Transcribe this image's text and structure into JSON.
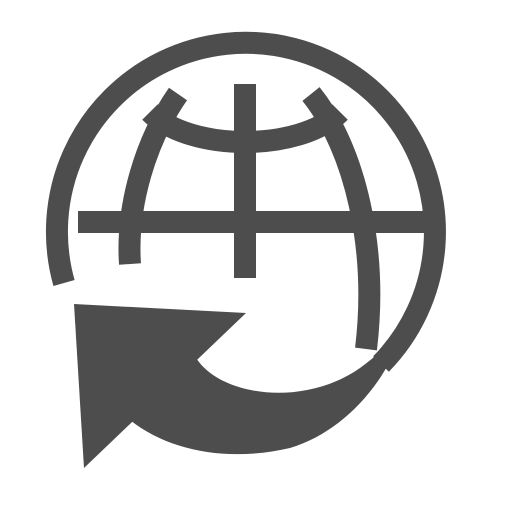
{
  "icon": {
    "name": "globe-return-arrow-icon",
    "parts": [
      "globe-icon",
      "curved-arrow-icon"
    ],
    "color": "#4d4d4d",
    "background": "#ffffff"
  }
}
